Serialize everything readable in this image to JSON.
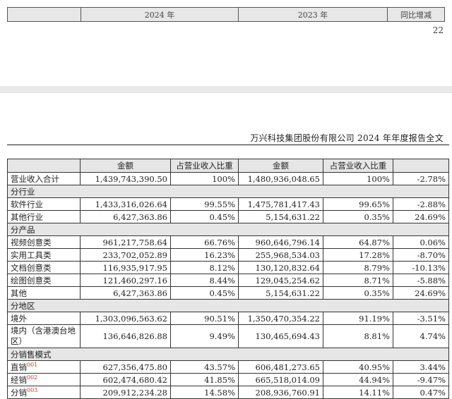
{
  "top_header": {
    "col1": "",
    "col2": "2024 年",
    "col3": "2023 年",
    "col4": "同比增减"
  },
  "page_number": "22",
  "doc_title": "万兴科技集团股份有限公司 2024 年年度报告全文",
  "table_header": [
    "",
    "金额",
    "占营业收入比重",
    "金额",
    "占营业收入比重",
    ""
  ],
  "rows": [
    {
      "type": "data",
      "label": "营业收入合计",
      "a24": "1,439,743,390.50",
      "p24": "100%",
      "a23": "1,480,936,048.65",
      "p23": "100%",
      "chg": "-2.78%"
    },
    {
      "type": "section",
      "label": "分行业"
    },
    {
      "type": "data",
      "label": "软件行业",
      "a24": "1,433,316,026.64",
      "p24": "99.55%",
      "a23": "1,475,781,417.43",
      "p23": "99.65%",
      "chg": "-2.88%"
    },
    {
      "type": "data",
      "label": "其他行业",
      "a24": "6,427,363.86",
      "p24": "0.45%",
      "a23": "5,154,631.22",
      "p23": "0.35%",
      "chg": "24.69%"
    },
    {
      "type": "section",
      "label": "分产品"
    },
    {
      "type": "data",
      "label": "视频创意类",
      "a24": "961,217,758.64",
      "p24": "66.76%",
      "a23": "960,646,796.14",
      "p23": "64.87%",
      "chg": "0.06%"
    },
    {
      "type": "data",
      "label": "实用工具类",
      "a24": "233,702,052.89",
      "p24": "16.23%",
      "a23": "255,968,534.03",
      "p23": "17.28%",
      "chg": "-8.70%"
    },
    {
      "type": "data",
      "label": "文档创意类",
      "a24": "116,935,917.95",
      "p24": "8.12%",
      "a23": "130,120,832.64",
      "p23": "8.79%",
      "chg": "-10.13%"
    },
    {
      "type": "data",
      "label": "绘图创意类",
      "a24": "121,460,297.16",
      "p24": "8.44%",
      "a23": "129,045,254.62",
      "p23": "8.71%",
      "chg": "-5.88%"
    },
    {
      "type": "data",
      "label": "其他",
      "a24": "6,427,363.86",
      "p24": "0.45%",
      "a23": "5,154,631.22",
      "p23": "0.35%",
      "chg": "24.69%"
    },
    {
      "type": "section",
      "label": "分地区"
    },
    {
      "type": "data",
      "label": "境外",
      "a24": "1,303,096,563.62",
      "p24": "90.51%",
      "a23": "1,350,470,354.22",
      "p23": "91.19%",
      "chg": "-3.51%"
    },
    {
      "type": "tall",
      "label": "境内（含港澳台地区）",
      "a24": "136,646,826.88",
      "p24": "9.49%",
      "a23": "130,465,694.43",
      "p23": "8.81%",
      "chg": "4.74%"
    },
    {
      "type": "section",
      "label": "分销售模式"
    },
    {
      "type": "data",
      "label": "直销",
      "sup": "001",
      "a24": "627,356,475.80",
      "p24": "43.57%",
      "a23": "606,481,273.65",
      "p23": "40.95%",
      "chg": "3.44%"
    },
    {
      "type": "data",
      "label": "经销",
      "sup": "002",
      "a24": "602,474,680.42",
      "p24": "41.85%",
      "a23": "665,518,014.09",
      "p23": "44.94%",
      "chg": "-9.47%"
    },
    {
      "type": "data",
      "label": "分销",
      "sup": "003",
      "a24": "209,912,234.28",
      "p24": "14.58%",
      "a23": "208,936,760.91",
      "p23": "14.11%",
      "chg": "0.47%"
    }
  ]
}
